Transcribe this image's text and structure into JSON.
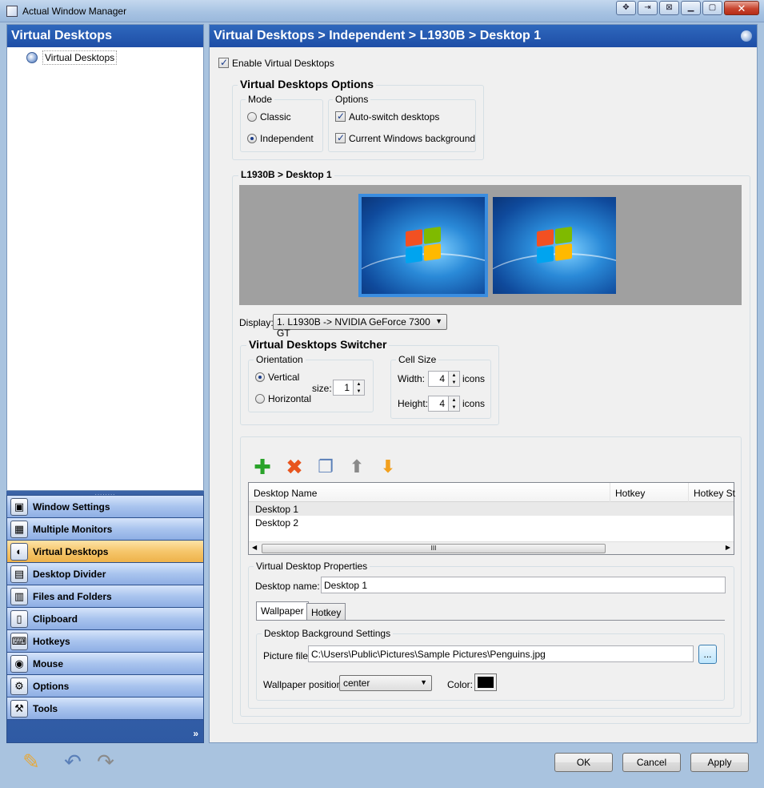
{
  "window": {
    "title": "Actual Window Manager"
  },
  "left": {
    "header": "Virtual Desktops",
    "tree_item": "Virtual Desktops",
    "splitter_dots": "........",
    "nav_items": [
      {
        "label": "Window Settings",
        "icon": "window-settings-icon",
        "glyph": "▣"
      },
      {
        "label": "Multiple Monitors",
        "icon": "monitors-icon",
        "glyph": "▦"
      },
      {
        "label": "Virtual Desktops",
        "icon": "virtual-desktops-icon",
        "glyph": "◐"
      },
      {
        "label": "Desktop Divider",
        "icon": "desktop-divider-icon",
        "glyph": "▤"
      },
      {
        "label": "Files and Folders",
        "icon": "folder-icon",
        "glyph": "▥"
      },
      {
        "label": "Clipboard",
        "icon": "clipboard-icon",
        "glyph": "▯"
      },
      {
        "label": "Hotkeys",
        "icon": "keyboard-icon",
        "glyph": "⌨"
      },
      {
        "label": "Mouse",
        "icon": "mouse-icon",
        "glyph": "◉"
      },
      {
        "label": "Options",
        "icon": "options-icon",
        "glyph": "⚙"
      },
      {
        "label": "Tools",
        "icon": "tools-icon",
        "glyph": "⚒"
      }
    ],
    "active_index": 2,
    "more_glyph": "»"
  },
  "right": {
    "header": "Virtual Desktops > Independent > L1930B > Desktop 1",
    "enable_label": "Enable Virtual Desktops",
    "options_group": {
      "title": "Virtual Desktops Options",
      "mode_title": "Mode",
      "mode_classic": "Classic",
      "mode_independent": "Independent",
      "options_title": "Options",
      "auto_switch": "Auto-switch desktops",
      "current_bg": "Current Windows background"
    },
    "preview_title": "L1930B > Desktop 1",
    "display": {
      "label": "Display:",
      "value": "1. L1930B -> NVIDIA GeForce 7300 GT"
    },
    "switcher": {
      "title": "Virtual Desktops Switcher",
      "orientation_title": "Orientation",
      "vertical": "Vertical",
      "horizontal": "Horizontal",
      "size_label": "size:",
      "size_value": "1",
      "cell_title": "Cell Size",
      "width_label": "Width:",
      "width_value": "4",
      "height_label": "Height:",
      "height_value": "4",
      "icons_unit": "icons"
    },
    "list": {
      "columns": [
        "Desktop Name",
        "Hotkey",
        "Hotkey St"
      ],
      "rows": [
        "Desktop 1",
        "Desktop 2"
      ],
      "selected_index": 0,
      "scroll_grip": "III"
    },
    "properties": {
      "title": "Virtual Desktop Properties",
      "name_label": "Desktop name:",
      "name_value": "Desktop 1",
      "tabs": [
        "Wallpaper",
        "Hotkey"
      ],
      "bg_title": "Desktop Background Settings",
      "picture_label": "Picture file:",
      "picture_value": "C:\\Users\\Public\\Pictures\\Sample Pictures\\Penguins.jpg",
      "browse_label": "...",
      "position_label": "Wallpaper position:",
      "position_value": "center",
      "color_label": "Color:",
      "color_value": "#000000"
    }
  },
  "buttons": {
    "ok": "OK",
    "cancel": "Cancel",
    "apply": "Apply"
  }
}
